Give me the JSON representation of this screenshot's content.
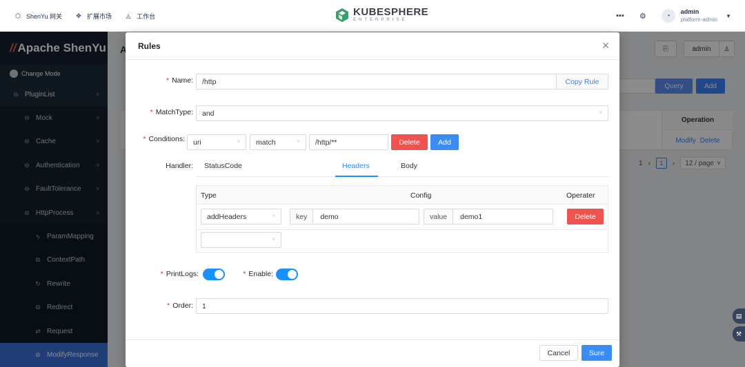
{
  "topbar": {
    "nav": [
      {
        "label": "ShenYu 网关",
        "icon": "gateway-icon"
      },
      {
        "label": "扩展市场",
        "icon": "extension-icon"
      },
      {
        "label": "工作台",
        "icon": "workbench-icon"
      }
    ],
    "logo": {
      "name": "KUBESPHERE",
      "sub": "ENTERPRISE"
    },
    "user": {
      "name": "admin",
      "role": "platform-admin"
    }
  },
  "sidebar": {
    "brand": "Apache ShenYu",
    "change_mode": "Change Mode",
    "items": [
      {
        "label": "PluginList",
        "level": 1,
        "icon": "plugin-icon",
        "arrow": "˄"
      },
      {
        "label": "Mock",
        "level": 2,
        "icon": "plugin-icon",
        "arrow": "˅"
      },
      {
        "label": "Cache",
        "level": 2,
        "icon": "plugin-icon",
        "arrow": "˅"
      },
      {
        "label": "Authentication",
        "level": 2,
        "icon": "plugin-icon",
        "arrow": "˅"
      },
      {
        "label": "FaultTolerance",
        "level": 2,
        "icon": "plugin-icon",
        "arrow": "˅"
      },
      {
        "label": "HttpProcess",
        "level": 2,
        "icon": "plugin-icon",
        "arrow": "˄"
      },
      {
        "label": "ParamMapping",
        "level": 3,
        "icon": "lightning-icon"
      },
      {
        "label": "ContextPath",
        "level": 3,
        "icon": "copy-icon"
      },
      {
        "label": "Rewrite",
        "level": 3,
        "icon": "refresh-icon"
      },
      {
        "label": "Redirect",
        "level": 3,
        "icon": "copy-icon"
      },
      {
        "label": "Request",
        "level": 3,
        "icon": "swap-icon"
      },
      {
        "label": "ModifyResponse",
        "level": 3,
        "icon": "stop-icon",
        "active": true
      }
    ]
  },
  "background": {
    "title_initial": "A",
    "admin_label": "admin",
    "query_label": "Query",
    "add_label": "Add",
    "operation_header": "Operation",
    "modify_label": "Modify",
    "delete_label": "Delete",
    "pager": {
      "current": "1",
      "page_size": "12 / page"
    }
  },
  "modal": {
    "title": "Rules",
    "name": {
      "label": "Name",
      "value": "/http",
      "copy_label": "Copy Rule"
    },
    "match_type": {
      "label": "MatchType",
      "value": "and"
    },
    "conditions": {
      "label": "Conditions",
      "param_type": "uri",
      "operator": "match",
      "value": "/http/**",
      "delete_label": "Delete",
      "add_label": "Add"
    },
    "handler": {
      "label": "Handler",
      "tabs": [
        "StatusCode",
        "Headers",
        "Body"
      ],
      "active_tab": "Headers",
      "table": {
        "columns": [
          "Type",
          "Config",
          "Operater"
        ],
        "rows": [
          {
            "type": "addHeaders",
            "key_label": "key",
            "key_value": "demo",
            "value_label": "value",
            "value_value": "demo1",
            "delete_label": "Delete"
          }
        ],
        "empty_select": ""
      }
    },
    "print_logs": {
      "label": "PrintLogs",
      "on": true
    },
    "enable": {
      "label": "Enable",
      "on": true
    },
    "order": {
      "label": "Order",
      "value": "1"
    },
    "footer": {
      "cancel_label": "Cancel",
      "sure_label": "Sure"
    }
  },
  "colors": {
    "primary": "#1890ff",
    "danger": "#ef5350",
    "sidebar_bg": "#1d2a3a",
    "sidebar_active": "#3a6fd8"
  }
}
